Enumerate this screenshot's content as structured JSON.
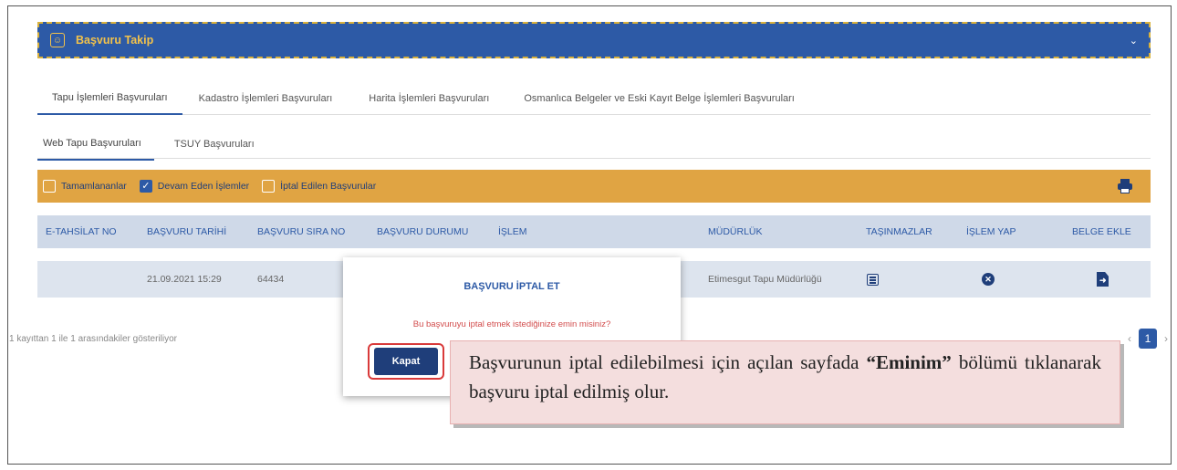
{
  "header": {
    "title": "Başvuru Takip",
    "icon": "smile-icon",
    "chevron": "chevron-down-icon"
  },
  "main_tabs": [
    {
      "label": "Tapu İşlemleri Başvuruları",
      "active": true
    },
    {
      "label": "Kadastro İşlemleri Başvuruları",
      "active": false
    },
    {
      "label": "Harita İşlemleri Başvuruları",
      "active": false
    },
    {
      "label": "Osmanlıca Belgeler ve Eski Kayıt Belge İşlemleri Başvuruları",
      "active": false
    }
  ],
  "sub_tabs": [
    {
      "label": "Web Tapu Başvuruları",
      "active": true
    },
    {
      "label": "TSUY Başvuruları",
      "active": false
    }
  ],
  "filters": [
    {
      "label": "Tamamlananlar",
      "checked": false
    },
    {
      "label": "Devam Eden İşlemler",
      "checked": true
    },
    {
      "label": "İptal Edilen Başvurular",
      "checked": false
    }
  ],
  "table": {
    "columns": [
      "E-TAHSİLAT NO",
      "BAŞVURU TARİHİ",
      "BAŞVURU SIRA NO",
      "BAŞVURU DURUMU",
      "İŞLEM",
      "MÜDÜRLÜK",
      "TAŞINMAZLAR",
      "İŞLEM YAP",
      "BELGE EKLE"
    ],
    "rows": [
      {
        "e_tahsilat": "",
        "tarih": "21.09.2021 15:29",
        "sira_no": "64434",
        "mudurluk": "Etimesgut Tapu Müdürlüğü"
      }
    ]
  },
  "pager": {
    "info": "1 kayıttan 1 ile 1 arasındakiler gösteriliyor",
    "current_page": "1",
    "prev": "‹",
    "next": "›"
  },
  "modal": {
    "title": "BAŞVURU İPTAL ET",
    "message": "Bu başvuruyu iptal etmek istediğinize emin misiniz?",
    "close_label": "Kapat"
  },
  "callout": {
    "text_before": "Başvurunun iptal edilebilmesi için açılan sayfada ",
    "bold": "“Eminim”",
    "text_after": " bölümü tıklanarak başvuru iptal edilmiş olur."
  },
  "colors": {
    "primary": "#2d5aa6",
    "accent": "#e0a443",
    "header_text": "#f3c24a",
    "danger": "#d93a3a"
  }
}
